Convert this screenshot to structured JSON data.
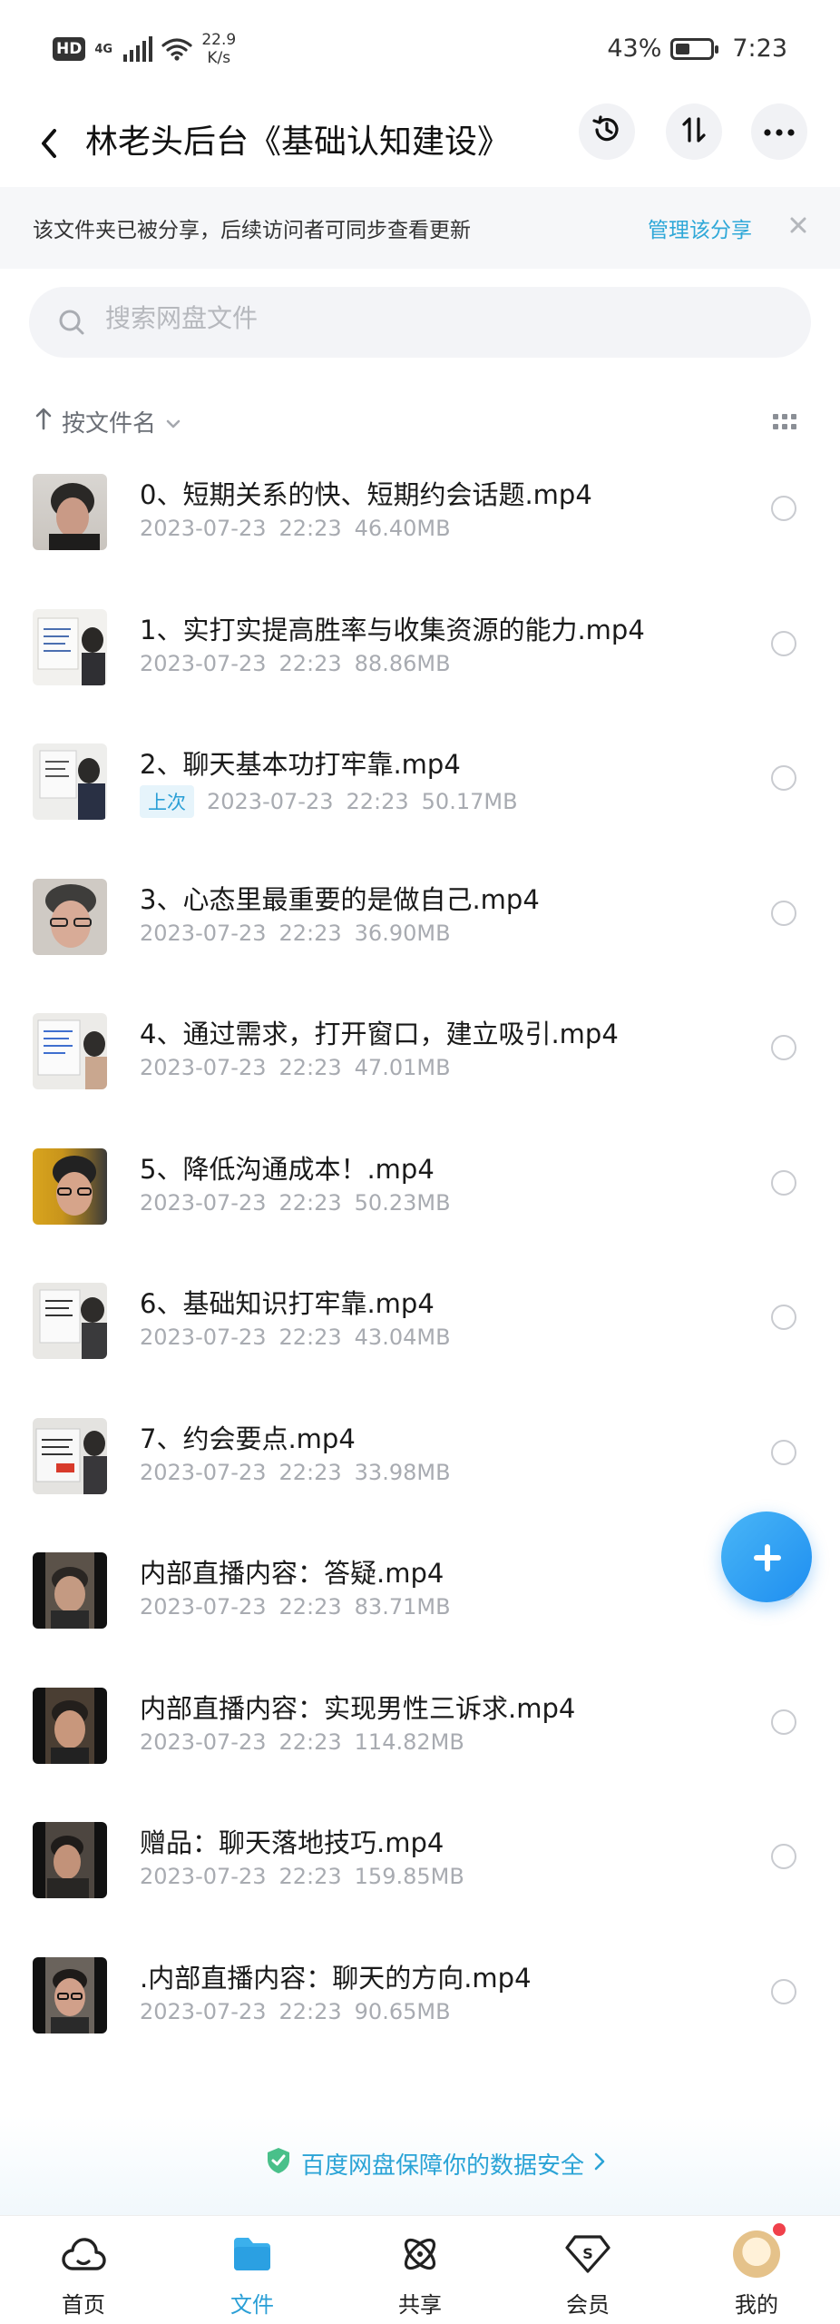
{
  "status_bar": {
    "hd": "HD",
    "network": "4G",
    "speed_value": "22.9",
    "speed_unit": "K/s",
    "battery": "43%",
    "battery_level": 0.43,
    "time": "7:23"
  },
  "header": {
    "title": "林老头后台《基础认知建设》",
    "icons": [
      "back-icon",
      "history-icon",
      "sort-transfer-icon",
      "more-icon"
    ]
  },
  "notice": {
    "text": "该文件夹已被分享，后续访问者可同步查看更新",
    "link": "管理该分享"
  },
  "search": {
    "placeholder": "搜索网盘文件"
  },
  "sort": {
    "label": "按文件名"
  },
  "files": [
    {
      "name": "0、短期关系的快、短期约会话题.mp4",
      "date": "2023-07-23",
      "time": "22:23",
      "size": "46.40MB",
      "badge": ""
    },
    {
      "name": "1、实打实提高胜率与收集资源的能力.mp4",
      "date": "2023-07-23",
      "time": "22:23",
      "size": "88.86MB",
      "badge": ""
    },
    {
      "name": "2、聊天基本功打牢靠.mp4",
      "date": "2023-07-23",
      "time": "22:23",
      "size": "50.17MB",
      "badge": "上次"
    },
    {
      "name": "3、心态里最重要的是做自己.mp4",
      "date": "2023-07-23",
      "time": "22:23",
      "size": "36.90MB",
      "badge": ""
    },
    {
      "name": "4、通过需求，打开窗口，建立吸引.mp4",
      "date": "2023-07-23",
      "time": "22:23",
      "size": "47.01MB",
      "badge": ""
    },
    {
      "name": "5、降低沟通成本！.mp4",
      "date": "2023-07-23",
      "time": "22:23",
      "size": "50.23MB",
      "badge": ""
    },
    {
      "name": "6、基础知识打牢靠.mp4",
      "date": "2023-07-23",
      "time": "22:23",
      "size": "43.04MB",
      "badge": ""
    },
    {
      "name": "7、约会要点.mp4",
      "date": "2023-07-23",
      "time": "22:23",
      "size": "33.98MB",
      "badge": ""
    },
    {
      "name": "内部直播内容：答疑.mp4",
      "date": "2023-07-23",
      "time": "22:23",
      "size": "83.71MB",
      "badge": ""
    },
    {
      "name": "内部直播内容：实现男性三诉求.mp4",
      "date": "2023-07-23",
      "time": "22:23",
      "size": "114.82MB",
      "badge": ""
    },
    {
      "name": "赠品：聊天落地技巧.mp4",
      "date": "2023-07-23",
      "time": "22:23",
      "size": "159.85MB",
      "badge": ""
    },
    {
      "name": ".内部直播内容：聊天的方向.mp4",
      "date": "2023-07-23",
      "time": "22:23",
      "size": "90.65MB",
      "badge": ""
    }
  ],
  "security": {
    "text": "百度网盘保障你的数据安全"
  },
  "tabs": [
    {
      "label": "首页",
      "icon": "home-cloud-icon",
      "active": false
    },
    {
      "label": "文件",
      "icon": "folder-icon",
      "active": true
    },
    {
      "label": "共享",
      "icon": "share-atom-icon",
      "active": false
    },
    {
      "label": "会员",
      "icon": "vip-diamond-icon",
      "active": false
    },
    {
      "label": "我的",
      "icon": "avatar-icon",
      "active": false
    }
  ],
  "colors": {
    "accent": "#2a9fd6",
    "fab": "#1e8ef0",
    "notification_dot": "#f0414b"
  }
}
